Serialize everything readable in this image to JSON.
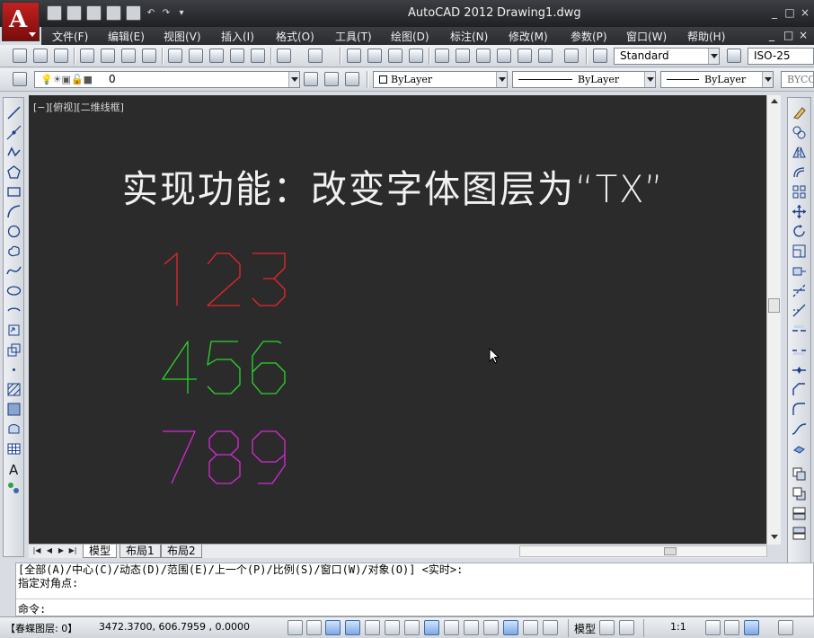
{
  "titlebar": {
    "app_title": "AutoCAD 2012",
    "document_title": "Drawing1.dwg",
    "logo_letter": "A",
    "quick_access": [
      "new-icon",
      "open-icon",
      "save-icon",
      "save-as-icon",
      "print-icon",
      "undo-icon",
      "redo-icon",
      "customize-icon"
    ],
    "window_controls": [
      "_",
      "□",
      "×"
    ]
  },
  "menubar": {
    "items": [
      "文件(F)",
      "编辑(E)",
      "视图(V)",
      "插入(I)",
      "格式(O)",
      "工具(T)",
      "绘图(D)",
      "标注(N)",
      "修改(M)",
      "参数(P)",
      "窗口(W)",
      "帮助(H)"
    ],
    "doc_controls": [
      "_",
      "□",
      "×"
    ]
  },
  "toolbar1": {
    "text_style": "Standard",
    "dim_style": "ISO-25"
  },
  "toolbar2": {
    "layer": "0",
    "color": "ByLayer",
    "linetype": "ByLayer",
    "lineweight": "ByLayer",
    "plot_style": "BYCOL"
  },
  "drawing": {
    "view_label": "[−][俯视][二维线框]",
    "heading": "实现功能：改变字体图层为“TX”",
    "rows": [
      {
        "text": "123",
        "color": "#e8262a"
      },
      {
        "text": "456",
        "color": "#2bd62b"
      },
      {
        "text": "789",
        "color": "#d629d6"
      }
    ],
    "background": "#2b2b2b"
  },
  "tabs": {
    "nav": [
      "|◀",
      "◀",
      "▶",
      "▶|"
    ],
    "items": [
      "模型",
      "布局1",
      "布局2"
    ],
    "active": "模型"
  },
  "command": {
    "history_line1": "[全部(A)/中心(C)/动态(D)/范围(E)/上一个(P)/比例(S)/窗口(W)/对象(O)] <实时>:",
    "history_line2": "指定对角点:",
    "prompt": "命令:"
  },
  "status": {
    "layer": "【春蝶图层: 0】",
    "coordinates": "3472.3700, 606.7959 , 0.0000",
    "model": "模型",
    "annotation_scale": "1:1"
  }
}
